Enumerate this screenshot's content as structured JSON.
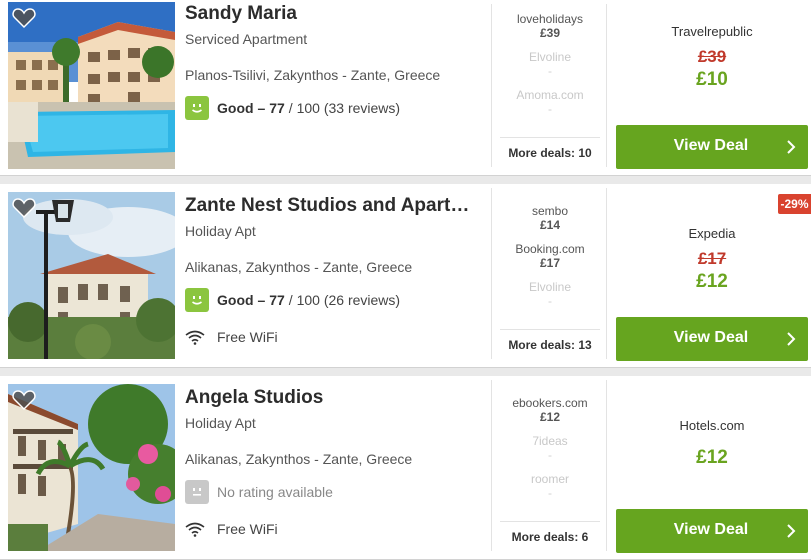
{
  "hotels": [
    {
      "name": "Sandy Maria",
      "type": "Serviced Apartment",
      "location": "Planos-Tsilivi, Zakynthos - Zante, Greece",
      "rating": {
        "label": "Good",
        "score": "– 77",
        "rest": "/ 100 (33 reviews)"
      },
      "wifi": "",
      "others": [
        {
          "site": "loveholidays",
          "price": "£39",
          "available": true
        },
        {
          "site": "Elvoline",
          "price": "-",
          "available": false
        },
        {
          "site": "Amoma.com",
          "price": "-",
          "available": false
        }
      ],
      "more_deals": "More deals: 10",
      "deal": {
        "site": "Travelrepublic",
        "old_price": "£39",
        "new_price": "£10",
        "button": "View Deal"
      },
      "discount": ""
    },
    {
      "name": "Zante Nest Studios and Apart…",
      "type": "Holiday Apt",
      "location": "Alikanas, Zakynthos - Zante, Greece",
      "rating": {
        "label": "Good",
        "score": "– 77",
        "rest": "/ 100 (26 reviews)"
      },
      "wifi": "Free WiFi",
      "others": [
        {
          "site": "sembo",
          "price": "£14",
          "available": true
        },
        {
          "site": "Booking.com",
          "price": "£17",
          "available": true
        },
        {
          "site": "Elvoline",
          "price": "-",
          "available": false
        }
      ],
      "more_deals": "More deals: 13",
      "deal": {
        "site": "Expedia",
        "old_price": "£17",
        "new_price": "£12",
        "button": "View Deal"
      },
      "discount": "-29%"
    },
    {
      "name": "Angela Studios",
      "type": "Holiday Apt",
      "location": "Alikanas, Zakynthos - Zante, Greece",
      "rating": {
        "no_rating": "No rating available"
      },
      "wifi": "Free WiFi",
      "others": [
        {
          "site": "ebookers.com",
          "price": "£12",
          "available": true
        },
        {
          "site": "7ideas",
          "price": "-",
          "available": false
        },
        {
          "site": "roomer",
          "price": "-",
          "available": false
        }
      ],
      "more_deals": "More deals: 6",
      "deal": {
        "site": "Hotels.com",
        "old_price": "",
        "new_price": "£12",
        "button": "View Deal"
      },
      "discount": ""
    }
  ],
  "colors": {
    "good": "#8bc53f",
    "deal_button": "#66a51f",
    "old_price": "#c0392b",
    "new_price": "#6aa420",
    "discount": "#d9432f"
  }
}
